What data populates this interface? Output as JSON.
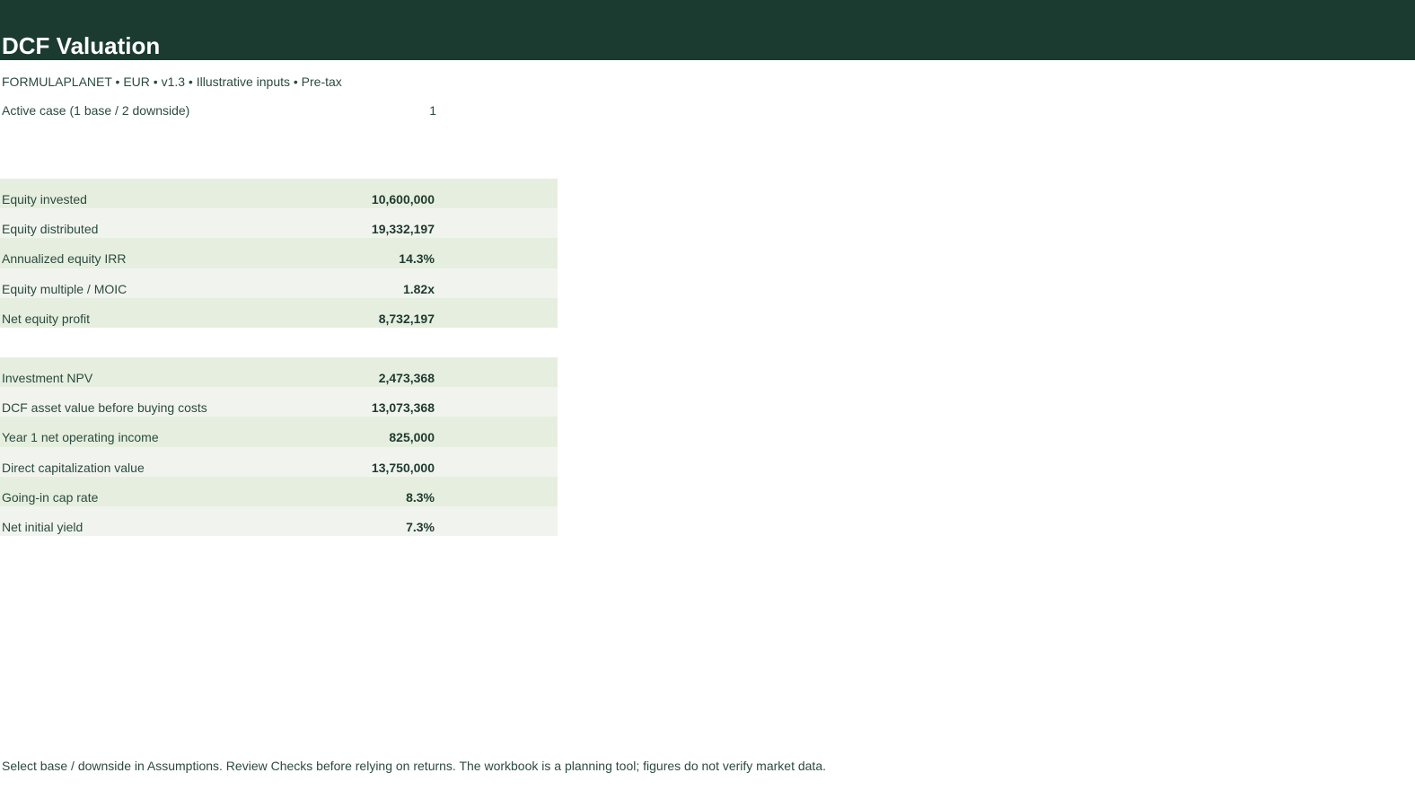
{
  "sheet": {
    "title": "DCF Valuation",
    "subtitle": "FORMULAPLANET  •  EUR  •  v1.3  •  Illustrative inputs  •  Pre-tax",
    "active_case": {
      "label": "Active case (1 base / 2 downside)",
      "value": "1"
    },
    "returns": [
      {
        "label": "Equity invested",
        "value": "10,600,000"
      },
      {
        "label": "Equity distributed",
        "value": "19,332,197"
      },
      {
        "label": "Annualized equity IRR",
        "value": "14.3%"
      },
      {
        "label": "Equity multiple / MOIC",
        "value": "1.82x"
      },
      {
        "label": "Net equity profit",
        "value": "8,732,197"
      }
    ],
    "valuation": [
      {
        "label": "Investment NPV",
        "value": "2,473,368"
      },
      {
        "label": "DCF asset value before buying costs",
        "value": "13,073,368"
      },
      {
        "label": "Year 1 net operating income",
        "value": "825,000"
      },
      {
        "label": "Direct capitalization value",
        "value": "13,750,000"
      },
      {
        "label": "Going-in cap rate",
        "value": "8.3%"
      },
      {
        "label": "Net initial yield",
        "value": "7.3%"
      }
    ],
    "footer": "Select base / downside in Assumptions. Review Checks before relying on returns. The workbook is a planning tool; figures do not verify market data."
  },
  "colors": {
    "header_band": "#1b3b30",
    "row_odd": "#e6efdf",
    "row_even": "#f1f4ee",
    "text": "#2b4a3f"
  }
}
